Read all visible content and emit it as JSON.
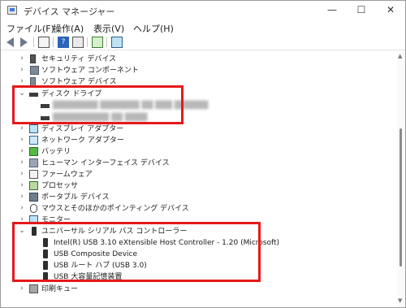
{
  "window": {
    "title": "デバイス マネージャー",
    "minimize": "—",
    "maximize": "☐",
    "close": "✕"
  },
  "menu": [
    "ファイル(F)",
    "操作(A)",
    "表示(V)",
    "ヘルプ(H)"
  ],
  "toolbar_icons": [
    "back-arrow-icon",
    "forward-arrow-icon",
    "properties-icon",
    "help-icon",
    "device-list-icon",
    "update-driver-icon",
    "scan-hardware-icon"
  ],
  "tree": {
    "items": [
      {
        "label": "セキュリティ デバイス",
        "icon": "security-device-icon",
        "expanded": false
      },
      {
        "label": "ソフトウェア コンポーネント",
        "icon": "software-component-icon",
        "expanded": false
      },
      {
        "label": "ソフトウェア デバイス",
        "icon": "software-device-icon",
        "expanded": false
      },
      {
        "label": "ディスク ドライブ",
        "icon": "disk-drive-icon",
        "expanded": true
      },
      {
        "label": "████████ ███████ ██ ███ ██████",
        "icon": "disk-drive-icon",
        "child": true,
        "obscured": true
      },
      {
        "label": "██████████ ██ ████",
        "icon": "disk-drive-icon",
        "child": true,
        "obscured": true
      },
      {
        "label": "ディスプレイ アダプター",
        "icon": "display-adapter-icon",
        "expanded": false
      },
      {
        "label": "ネットワーク アダプター",
        "icon": "network-adapter-icon",
        "expanded": false
      },
      {
        "label": "バッテリ",
        "icon": "battery-icon",
        "expanded": false
      },
      {
        "label": "ヒューマン インターフェイス デバイス",
        "icon": "hid-icon",
        "expanded": false
      },
      {
        "label": "ファームウェア",
        "icon": "firmware-icon",
        "expanded": false
      },
      {
        "label": "プロセッサ",
        "icon": "processor-icon",
        "expanded": false
      },
      {
        "label": "ポータブル デバイス",
        "icon": "portable-device-icon",
        "expanded": false
      },
      {
        "label": "マウスとそのほかのポインティング デバイス",
        "icon": "mouse-icon",
        "expanded": false
      },
      {
        "label": "モニター",
        "icon": "monitor-icon",
        "expanded": false
      },
      {
        "label": "ユニバーサル シリアル バス コントローラー",
        "icon": "usb-icon",
        "expanded": true
      },
      {
        "label": "Intel(R) USB 3.10 eXtensible Host Controller - 1.20 (Microsoft)",
        "icon": "usb-icon",
        "child": true
      },
      {
        "label": "USB Composite Device",
        "icon": "usb-icon",
        "child": true
      },
      {
        "label": "USB ルート ハブ (USB 3.0)",
        "icon": "usb-icon",
        "child": true
      },
      {
        "label": "USB 大容量記憶装置",
        "icon": "usb-icon",
        "child": true
      },
      {
        "label": "印刷キュー",
        "icon": "print-queue-icon",
        "expanded": false
      }
    ]
  },
  "colors": {
    "highlight": "#e5191a",
    "selection": "#ffffff"
  }
}
